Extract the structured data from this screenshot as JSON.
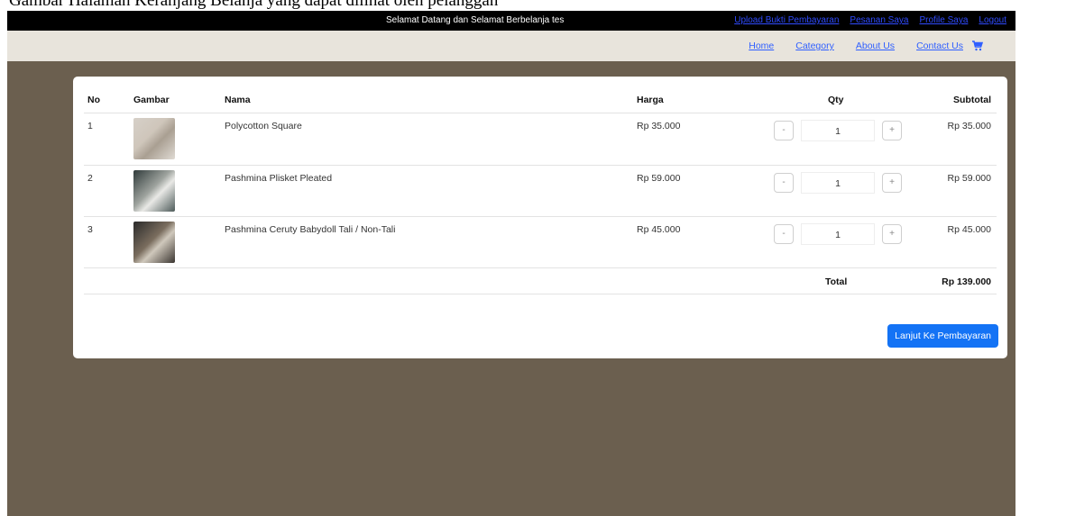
{
  "caption": "Gambar Halaman Keranjang Belanja yang dapat dilihat oleh pelanggan",
  "topbar": {
    "welcome": "Selamat Datang dan Selamat Berbelanja tes",
    "links": [
      "Upload Bukti Pembayaran",
      "Pesanan Saya",
      "Profile Saya",
      "Logout"
    ]
  },
  "navbar": {
    "links": [
      "Home",
      "Category",
      "About Us",
      "Contact Us"
    ],
    "cart_icon": "cart-icon"
  },
  "table": {
    "headers": [
      "No",
      "Gambar",
      "Nama",
      "Harga",
      "Qty",
      "Subtotal"
    ],
    "rows": [
      {
        "no": "1",
        "nama": "Polycotton Square",
        "harga": "Rp 35.000",
        "qty": "1",
        "subtotal": "Rp 35.000"
      },
      {
        "no": "2",
        "nama": "Pashmina Plisket Pleated",
        "harga": "Rp 59.000",
        "qty": "1",
        "subtotal": "Rp 59.000"
      },
      {
        "no": "3",
        "nama": "Pashmina Ceruty Babydoll Tali / Non-Tali",
        "harga": "Rp 45.000",
        "qty": "1",
        "subtotal": "Rp 45.000"
      }
    ],
    "minus": "-",
    "plus": "+",
    "total_label": "Total",
    "total_value": "Rp 139.000"
  },
  "pay_button": "Lanjut Ke Pembayaran",
  "colors": {
    "page_bg": "#6b5f4f",
    "nav_bg": "#e8e4dc",
    "primary": "#1473f5"
  }
}
